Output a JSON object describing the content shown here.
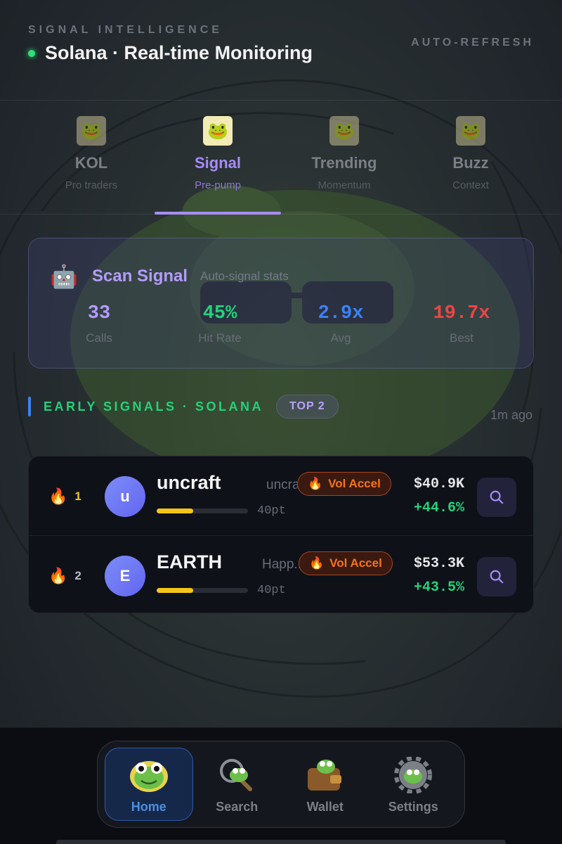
{
  "header": {
    "kicker": "SIGNAL INTELLIGENCE",
    "title": "Solana · Real-time Monitoring",
    "auto_refresh": "AUTO-REFRESH"
  },
  "tabs": [
    {
      "label": "KOL",
      "sub": "Pro traders",
      "icon": "frog-pointing-icon",
      "active": false
    },
    {
      "label": "Signal",
      "sub": "Pre-pump",
      "icon": "frog-signal-icon",
      "active": true
    },
    {
      "label": "Trending",
      "sub": "Momentum",
      "icon": "frog-running-icon",
      "active": false
    },
    {
      "label": "Buzz",
      "sub": "Context",
      "icon": "frog-confetti-icon",
      "active": false
    }
  ],
  "scan": {
    "icon": "robot-icon",
    "title": "Scan Signal",
    "subtitle": "Auto-signal stats",
    "stats": [
      {
        "value": "33",
        "label": "Calls",
        "color": "#b39cfb"
      },
      {
        "value": "45%",
        "label": "Hit Rate",
        "color": "#22d37a"
      },
      {
        "value": "2.9x",
        "label": "Avg",
        "color": "#3b82f6"
      },
      {
        "value": "19.7x",
        "label": "Best",
        "color": "#ef4444"
      }
    ]
  },
  "section": {
    "title": "EARLY SIGNALS · SOLANA",
    "badge": "TOP 2",
    "updated": "1m ago"
  },
  "signals": [
    {
      "rank": "1",
      "avatar": "u",
      "name": "uncraft",
      "ticker": "uncraft",
      "tag": "Vol Accel",
      "score": "40pt",
      "score_fraction": 0.4,
      "mcap": "$40.9K",
      "change": "+44.6%",
      "rank_color": "#f5c518"
    },
    {
      "rank": "2",
      "avatar": "E",
      "name": "EARTH",
      "ticker": "Happ...",
      "tag": "Vol Accel",
      "score": "40pt",
      "score_fraction": 0.4,
      "mcap": "$53.3K",
      "change": "+43.5%",
      "rank_color": "#b8bcc6"
    }
  ],
  "nav": [
    {
      "label": "Home",
      "icon": "frog-face-icon",
      "active": true
    },
    {
      "label": "Search",
      "icon": "frog-magnifier-icon",
      "active": false
    },
    {
      "label": "Wallet",
      "icon": "frog-wallet-icon",
      "active": false
    },
    {
      "label": "Settings",
      "icon": "frog-gear-icon",
      "active": false
    }
  ]
}
